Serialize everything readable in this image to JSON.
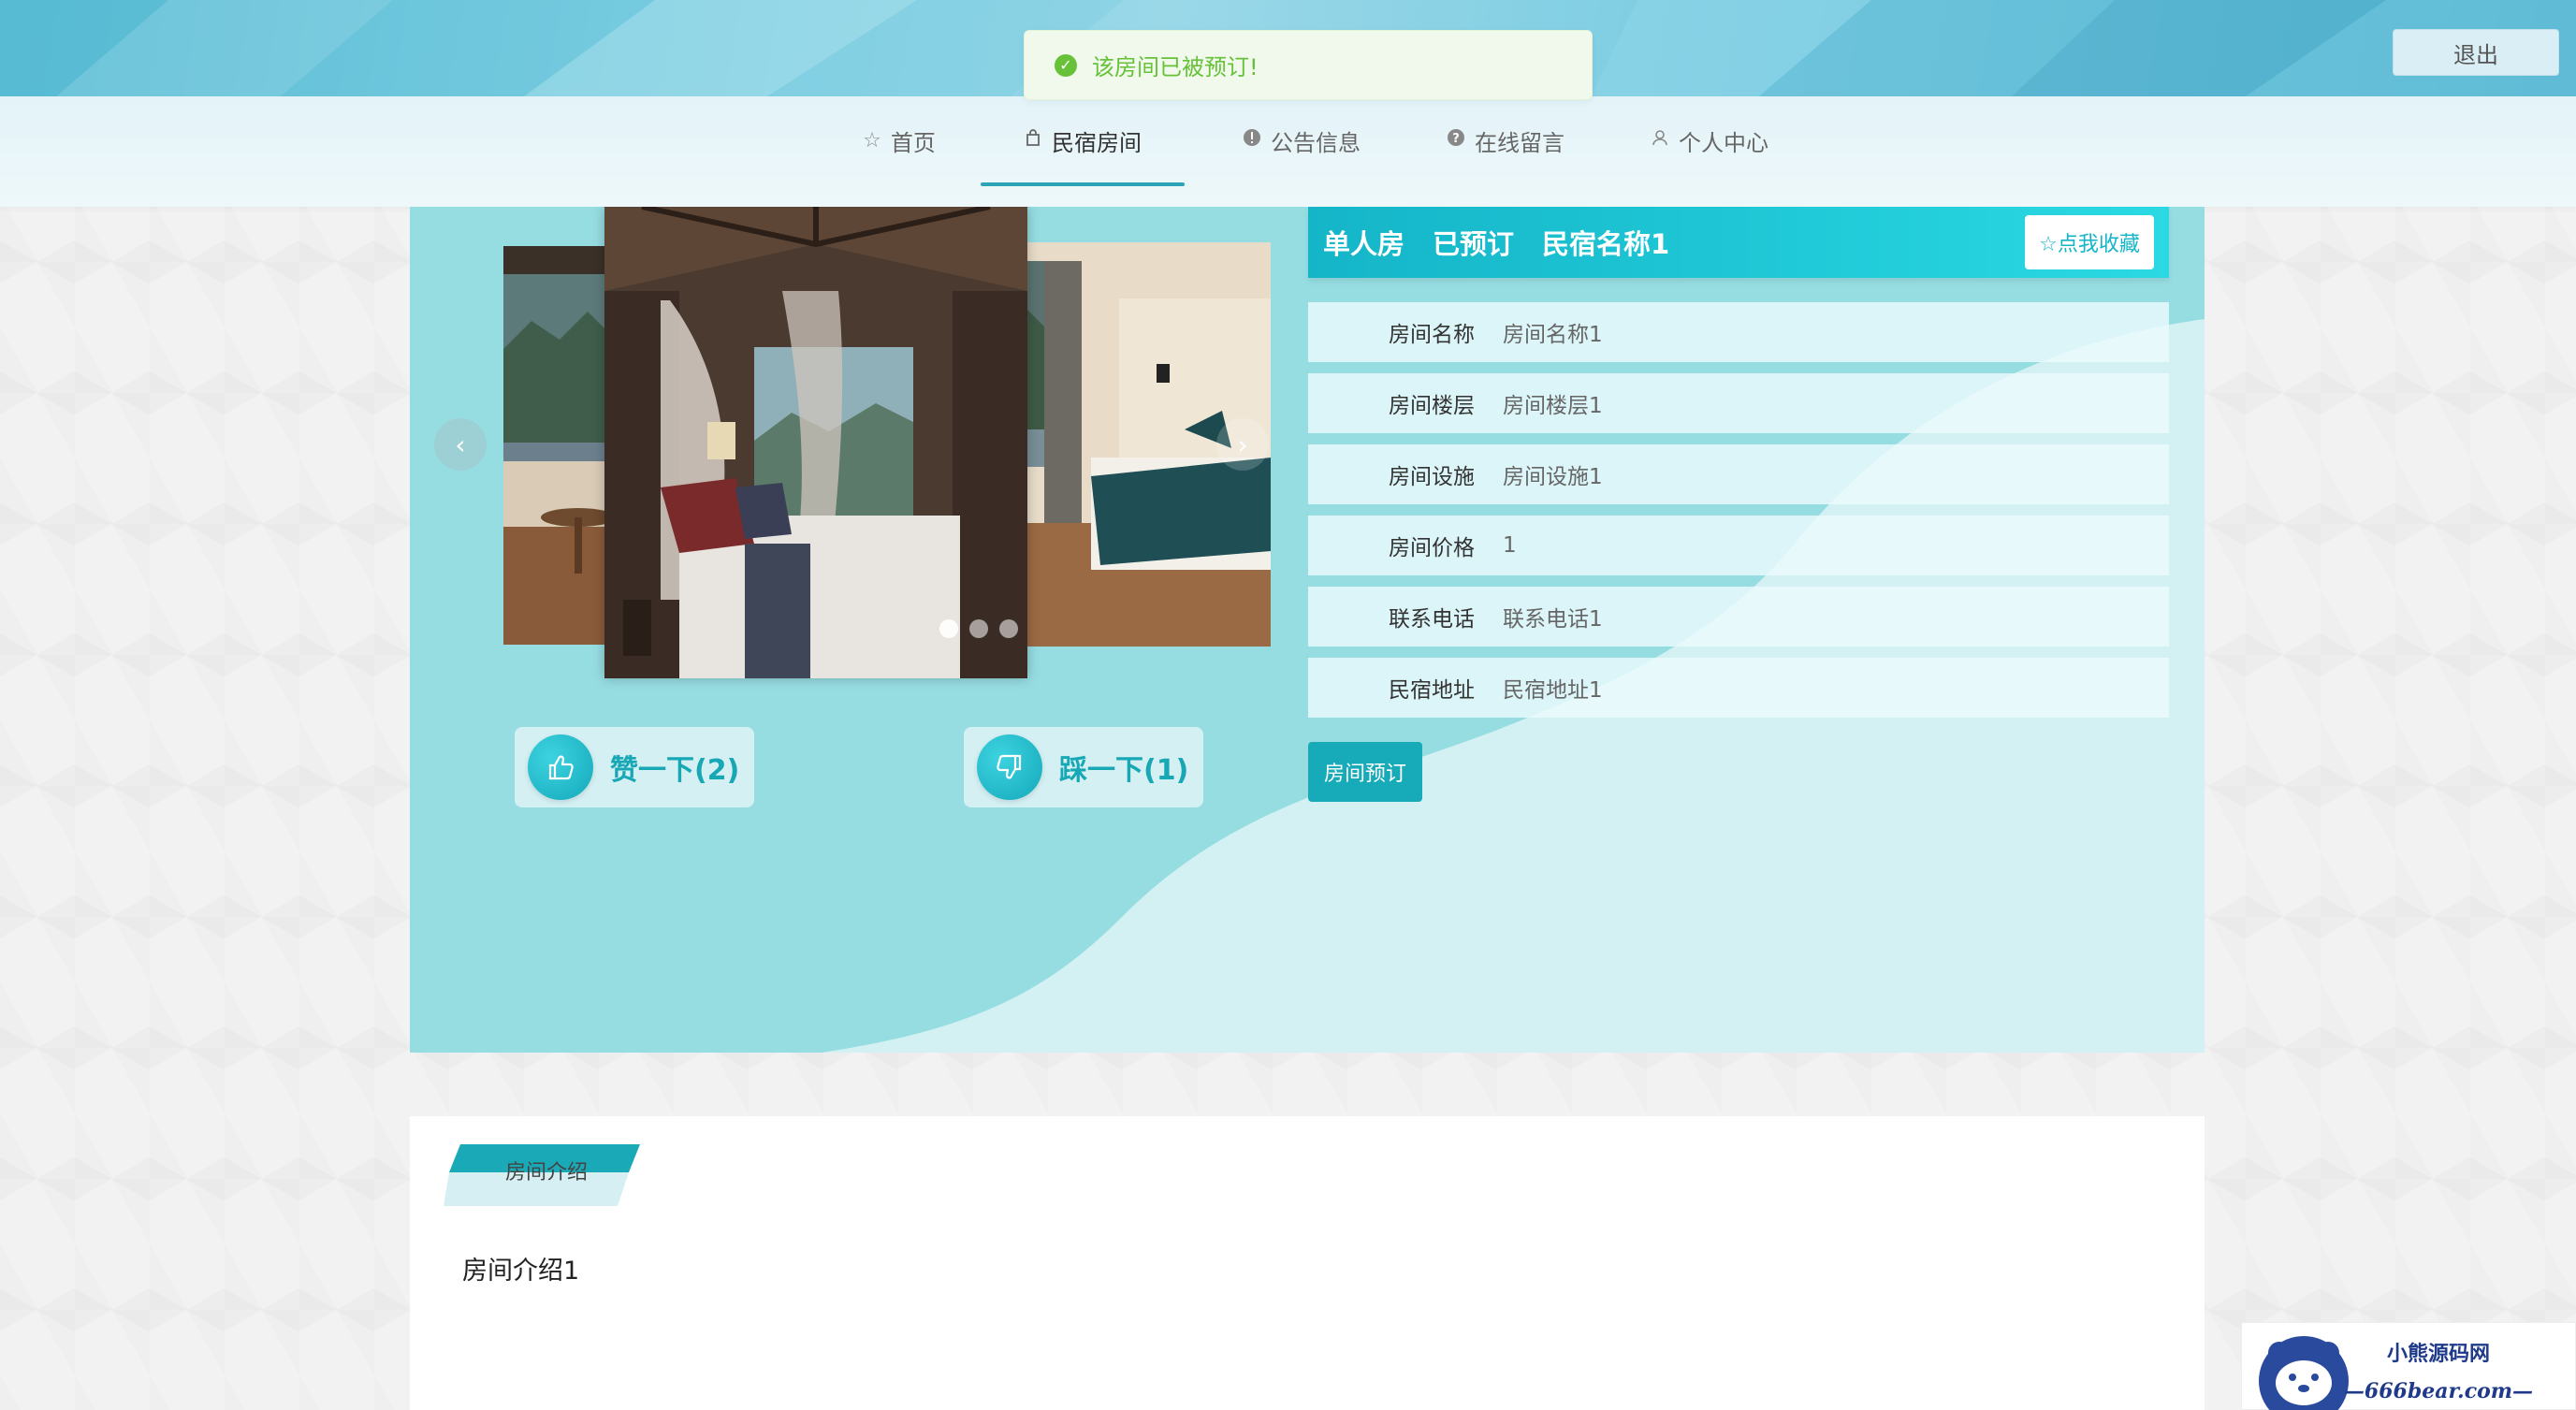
{
  "header": {
    "logout_label": "退出"
  },
  "toast": {
    "message": "该房间已被预订!",
    "icon": "check-circle-icon",
    "color": "#67c23a"
  },
  "nav": {
    "items": [
      {
        "label": "首页",
        "icon": "star-icon"
      },
      {
        "label": "民宿房间",
        "icon": "bag-icon",
        "active": true
      },
      {
        "label": "公告信息",
        "icon": "exclamation-icon"
      },
      {
        "label": "在线留言",
        "icon": "question-icon"
      },
      {
        "label": "个人中心",
        "icon": "user-icon"
      }
    ],
    "accent": "#2ba4b5"
  },
  "room": {
    "type": "单人房",
    "status": "已预订",
    "name": "民宿名称1",
    "favorite_label": "☆点我收藏",
    "like_label": "赞一下(2)",
    "dislike_label": "踩一下(1)",
    "book_label": "房间预订",
    "fields": [
      {
        "label": "房间名称",
        "value": "房间名称1"
      },
      {
        "label": "房间楼层",
        "value": "房间楼层1"
      },
      {
        "label": "房间设施",
        "value": "房间设施1"
      },
      {
        "label": "房间价格",
        "value": "1"
      },
      {
        "label": "联系电话",
        "value": "联系电话1"
      },
      {
        "label": "民宿地址",
        "value": "民宿地址1"
      }
    ],
    "carousel": {
      "slide_count": 3,
      "active_index": 0,
      "prev_icon": "chevron-left-icon",
      "next_icon": "chevron-right-icon"
    }
  },
  "intro": {
    "tab_label": "房间介绍",
    "text": "房间介绍1"
  },
  "colors": {
    "panel_bg": "#96dde2",
    "primary": "#17aab8"
  }
}
